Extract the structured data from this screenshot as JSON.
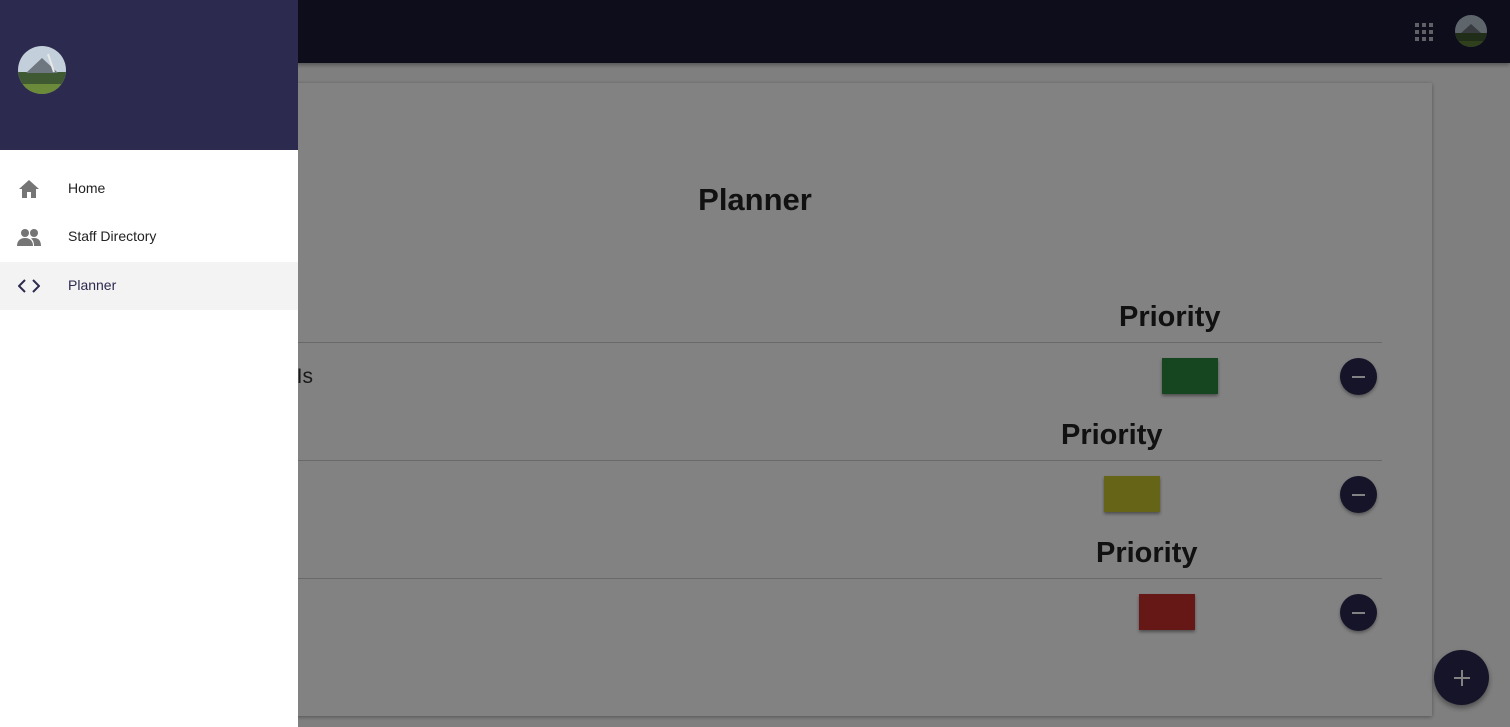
{
  "appbar": {
    "apps_icon": "apps-grid-icon",
    "account_avatar": "user-avatar"
  },
  "drawer": {
    "avatar": "user-avatar",
    "items": [
      {
        "label": "Home",
        "icon": "home-icon",
        "active": false
      },
      {
        "label": "Staff Directory",
        "icon": "people-icon",
        "active": false
      },
      {
        "label": "Planner",
        "icon": "code-icon",
        "active": true
      }
    ]
  },
  "main": {
    "title": "Planner",
    "rows": [
      {
        "priority_label": "Priority",
        "task": "rt Is",
        "priority_color": "#2b8a3e",
        "priority_level": "low",
        "remove_icon": "minus-icon"
      },
      {
        "priority_label": "Priority",
        "task": "",
        "priority_color": "#c9c42e",
        "priority_level": "medium",
        "remove_icon": "minus-icon"
      },
      {
        "priority_label": "Priority",
        "task": "",
        "priority_color": "#c9302c",
        "priority_level": "high",
        "remove_icon": "minus-icon"
      }
    ],
    "add_icon": "plus-icon"
  },
  "colors": {
    "primary": "#1c1a38",
    "drawer_header": "#2c2a4e",
    "accent": "#2b2950"
  }
}
